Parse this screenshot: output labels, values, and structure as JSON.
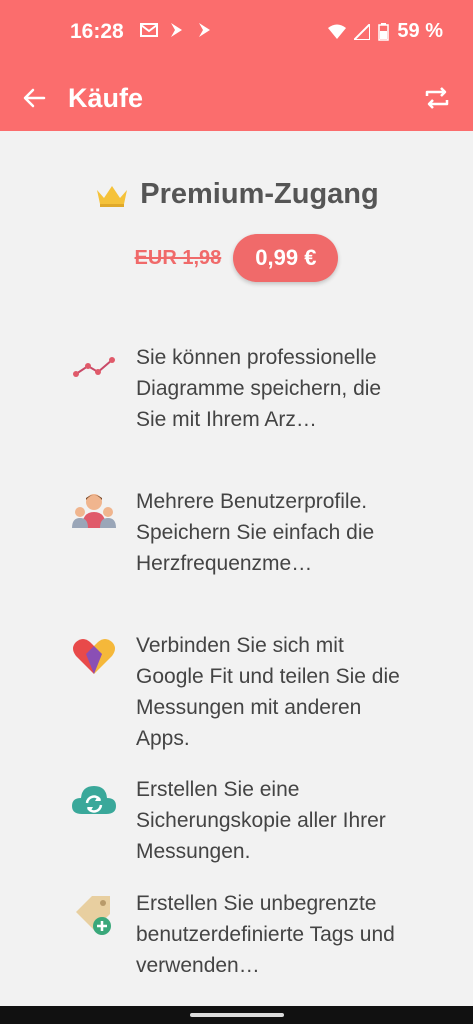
{
  "status": {
    "time": "16:28",
    "battery": "59 %"
  },
  "appbar": {
    "title": "Käufe"
  },
  "premium": {
    "title": "Premium-Zugang",
    "old_price": "EUR 1,98",
    "price": "0,99 €"
  },
  "features": [
    {
      "icon": "chart-line-icon",
      "text": "Sie können professionelle Diagramme speichern, die Sie mit Ihrem Arz…"
    },
    {
      "icon": "users-icon",
      "text": "Mehrere Benutzerprofile. Speichern Sie einfach die Herzfrequenzme…"
    },
    {
      "icon": "google-fit-heart-icon",
      "text": "Verbinden Sie sich mit Google Fit und teilen Sie die Messungen mit anderen Apps."
    },
    {
      "icon": "cloud-sync-icon",
      "text": "Erstellen Sie eine Sicherungskopie aller Ihrer Messungen."
    },
    {
      "icon": "tag-add-icon",
      "text": "Erstellen Sie unbegrenzte benutzerdefinierte Tags und verwenden…"
    }
  ],
  "colors": {
    "accent": "#fb6d6d",
    "price": "#f06a6a",
    "background": "#f2f2f2"
  }
}
